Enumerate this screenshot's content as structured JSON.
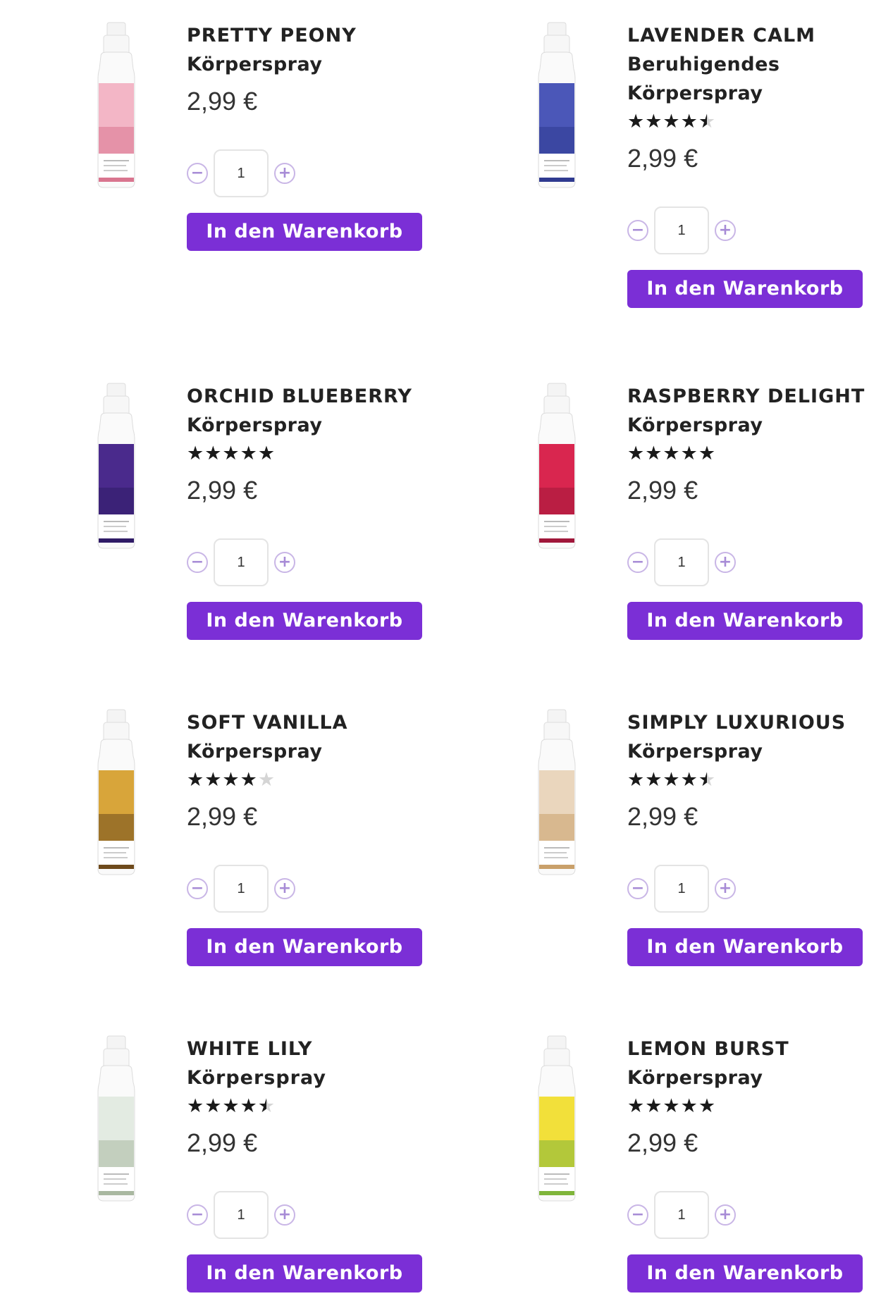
{
  "products": [
    {
      "title": "PRETTY PEONY",
      "lines": [
        "Körperspray"
      ],
      "rating": null,
      "price": "2,99 €",
      "qty": "1",
      "cart_label": "In den Warenkorb",
      "bottle_color": "#f3b6c6",
      "bottle_accent": "#d9758f"
    },
    {
      "title": "LAVENDER CALM",
      "lines": [
        "Beruhigendes",
        "Körperspray"
      ],
      "rating": 4.5,
      "price": "2,99 €",
      "qty": "1",
      "cart_label": "In den Warenkorb",
      "bottle_color": "#4b57b8",
      "bottle_accent": "#2f3a90"
    },
    {
      "title": "ORCHID BLUEBERRY",
      "lines": [
        "Körperspray"
      ],
      "rating": 5,
      "price": "2,99 €",
      "qty": "1",
      "cart_label": "In den Warenkorb",
      "bottle_color": "#4a2a8c",
      "bottle_accent": "#2f1b66"
    },
    {
      "title": "RASPBERRY DELIGHT",
      "lines": [
        "Körperspray"
      ],
      "rating": 5,
      "price": "2,99 €",
      "qty": "1",
      "cart_label": "In den Warenkorb",
      "bottle_color": "#d9264f",
      "bottle_accent": "#a0173a"
    },
    {
      "title": "SOFT VANILLA",
      "lines": [
        "Körperspray"
      ],
      "rating": 4,
      "price": "2,99 €",
      "qty": "1",
      "cart_label": "In den Warenkorb",
      "bottle_color": "#d8a53a",
      "bottle_accent": "#6e4a1c"
    },
    {
      "title": "SIMPLY LUXURIOUS",
      "lines": [
        "Körperspray"
      ],
      "rating": 4.5,
      "price": "2,99 €",
      "qty": "1",
      "cart_label": "In den Warenkorb",
      "bottle_color": "#ead6bd",
      "bottle_accent": "#c9a06a"
    },
    {
      "title": "WHITE LILY Körperspray",
      "lines": [],
      "rating": 4.5,
      "price": "2,99 €",
      "qty": "1",
      "cart_label": "In den Warenkorb",
      "bottle_color": "#e3ebe2",
      "bottle_accent": "#a9b8a0"
    },
    {
      "title": "LEMON BURST",
      "lines": [
        "Körperspray"
      ],
      "rating": 5,
      "price": "2,99 €",
      "qty": "1",
      "cart_label": "In den Warenkorb",
      "bottle_color": "#f2e03a",
      "bottle_accent": "#7fb53a"
    }
  ],
  "icons": {
    "minus": "minus-circle-icon",
    "plus": "plus-circle-icon",
    "star": "star-icon"
  },
  "accent_color": "#7b2fd6"
}
